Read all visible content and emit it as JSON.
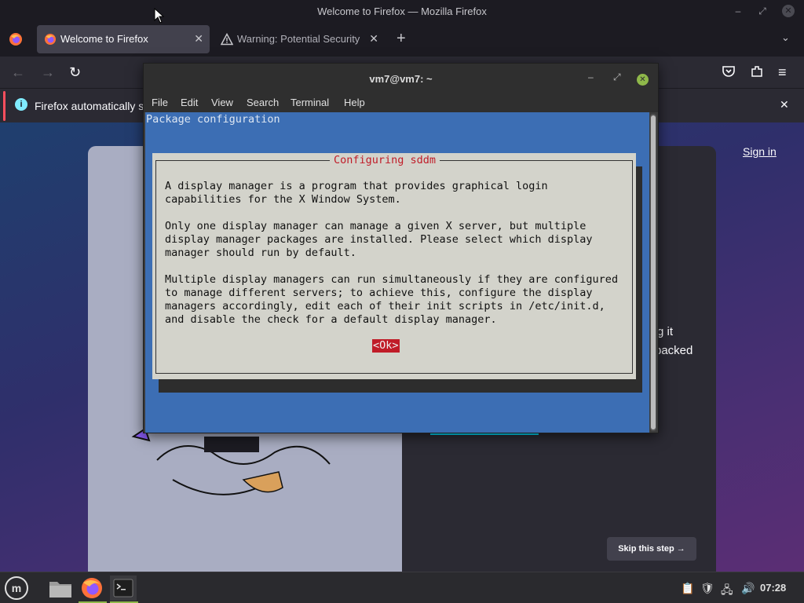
{
  "firefox": {
    "window_title": "Welcome to Firefox — Mozilla Firefox",
    "tabs": [
      {
        "label": "Welcome to Firefox",
        "active": true,
        "icon": "firefox-icon"
      },
      {
        "label": "Warning: Potential Security",
        "active": false,
        "icon": "warning-icon"
      }
    ],
    "notification": "Firefox automatically se",
    "page": {
      "sign_in": "Sign in",
      "fragment_1": "g it",
      "fragment_2": "packed",
      "skip_button": "Skip this step →"
    }
  },
  "terminal": {
    "title": "vm7@vm7: ~",
    "menu": [
      "File",
      "Edit",
      "View",
      "Search",
      "Terminal",
      "Help"
    ],
    "backtitle": "Package configuration",
    "dialog": {
      "title": "Configuring sddm",
      "body": "A display manager is a program that provides graphical login\ncapabilities for the X Window System.\n\nOnly one display manager can manage a given X server, but multiple\ndisplay manager packages are installed. Please select which display\nmanager should run by default.\n\nMultiple display managers can run simultaneously if they are configured\nto manage different servers; to achieve this, configure the display\nmanagers accordingly, edit each of their init scripts in /etc/init.d,\nand disable the check for a default display manager.",
      "ok_button": "<Ok>"
    }
  },
  "taskbar": {
    "clock": "07:28",
    "launchers": [
      "files-icon",
      "firefox-icon",
      "terminal-icon"
    ]
  },
  "colors": {
    "dialog_bg": "#d3d3cb",
    "screen_bg": "#3c6eb4",
    "accent_red": "#c01c28",
    "taskbar_accent": "#8fb84a"
  }
}
